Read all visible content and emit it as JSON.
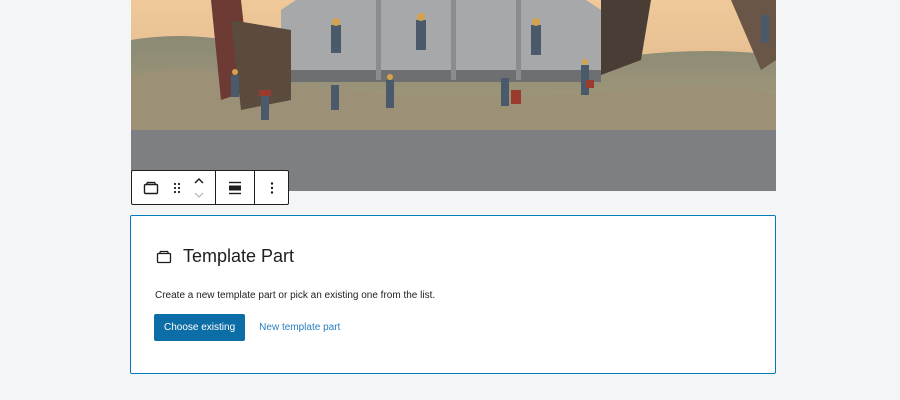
{
  "media": {
    "description_icon": "image"
  },
  "toolbar": {
    "block_type_icon": "template-part-icon",
    "drag_icon": "drag-handle-icon",
    "move_up_icon": "chevron-up-icon",
    "move_down_icon": "chevron-down-icon",
    "align_icon": "align-icon",
    "more_icon": "more-vertical-icon"
  },
  "placeholder": {
    "icon": "template-part-icon",
    "title": "Template Part",
    "instructions": "Create a new template part or pick an existing one from the list.",
    "choose_existing_label": "Choose existing",
    "new_template_part_label": "New template part"
  },
  "colors": {
    "accent": "#007cba",
    "primary_button": "#0d6da6",
    "link": "#2b7fbf",
    "canvas": "#f4f5f7"
  }
}
